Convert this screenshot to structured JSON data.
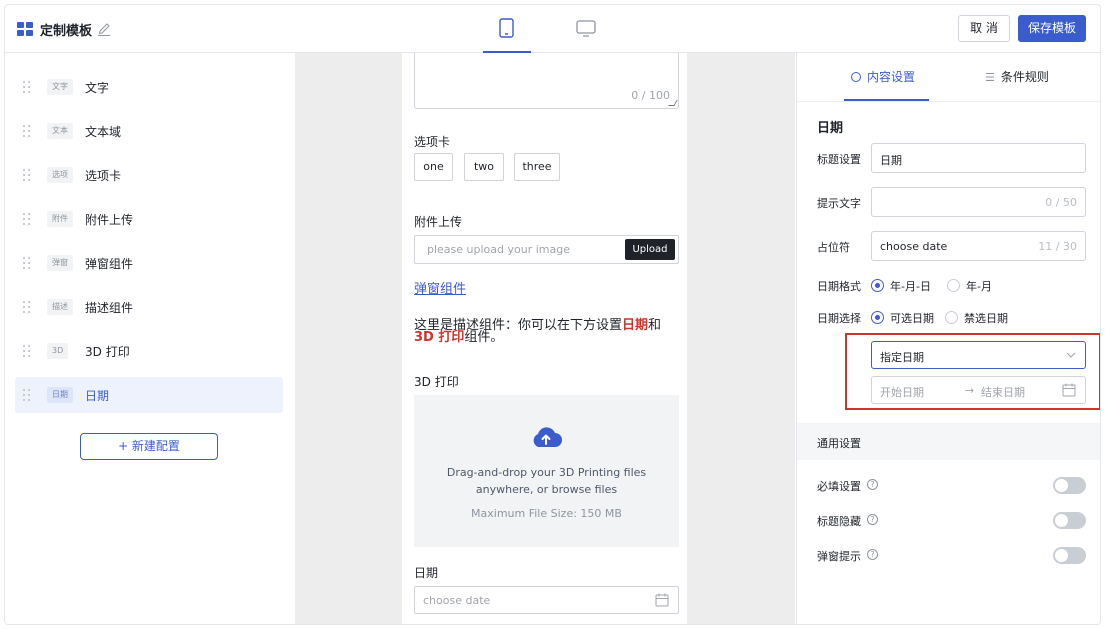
{
  "header": {
    "title": "定制模板",
    "cancel_label": "取 消",
    "save_label": "保存模板"
  },
  "sidebar": {
    "items": [
      {
        "tag": "文字",
        "label": "文字"
      },
      {
        "tag": "文本",
        "label": "文本域"
      },
      {
        "tag": "选项",
        "label": "选项卡"
      },
      {
        "tag": "附件",
        "label": "附件上传"
      },
      {
        "tag": "弹窗",
        "label": "弹窗组件"
      },
      {
        "tag": "描述",
        "label": "描述组件"
      },
      {
        "tag": "3D",
        "label": "3D 打印"
      },
      {
        "tag": "日期",
        "label": "日期"
      }
    ],
    "new_button": "+ 新建配置"
  },
  "canvas": {
    "textarea_counter": "0 / 100",
    "tabs_label": "选项卡",
    "tabs": [
      "one",
      "two",
      "three"
    ],
    "upload_label": "附件上传",
    "upload_placeholder": "please upload your image",
    "upload_button": "Upload",
    "popup_link": "弹窗组件",
    "desc_prefix": "这里是描述组件：你可以在下方设置",
    "desc_highlight1": "日期",
    "desc_middle": "和 ",
    "desc_highlight2": "3D 打印",
    "desc_suffix": "组件。",
    "print_label": "3D 打印",
    "dropzone_line1": "Drag-and-drop your 3D Printing files",
    "dropzone_line2": "anywhere, or browse files",
    "dropzone_size": "Maximum File Size: 150 MB",
    "date_label": "日期",
    "date_placeholder": "choose date"
  },
  "panel": {
    "tab_content": "内容设置",
    "tab_rules": "条件规则",
    "section_title": "日期",
    "title_label": "标题设置",
    "title_value": "日期",
    "hint_label": "提示文字",
    "hint_counter": "0 / 50",
    "placeholder_label": "占位符",
    "placeholder_value": "choose date",
    "placeholder_counter": "11 / 30",
    "format_label": "日期格式",
    "format_opt1": "年-月-日",
    "format_opt2": "年-月",
    "select_label": "日期选择",
    "select_opt1": "可选日期",
    "select_opt2": "禁选日期",
    "select_value": "指定日期",
    "range_start": "开始日期",
    "range_arrow": "→",
    "range_end": "结束日期",
    "general_title": "通用设置",
    "required_label": "必填设置",
    "hide_title_label": "标题隐藏",
    "popup_tip_label": "弹窗提示",
    "help_glyph": "?"
  },
  "colors": {
    "accent": "#3a5ccc",
    "highlight": "#d0342c"
  }
}
